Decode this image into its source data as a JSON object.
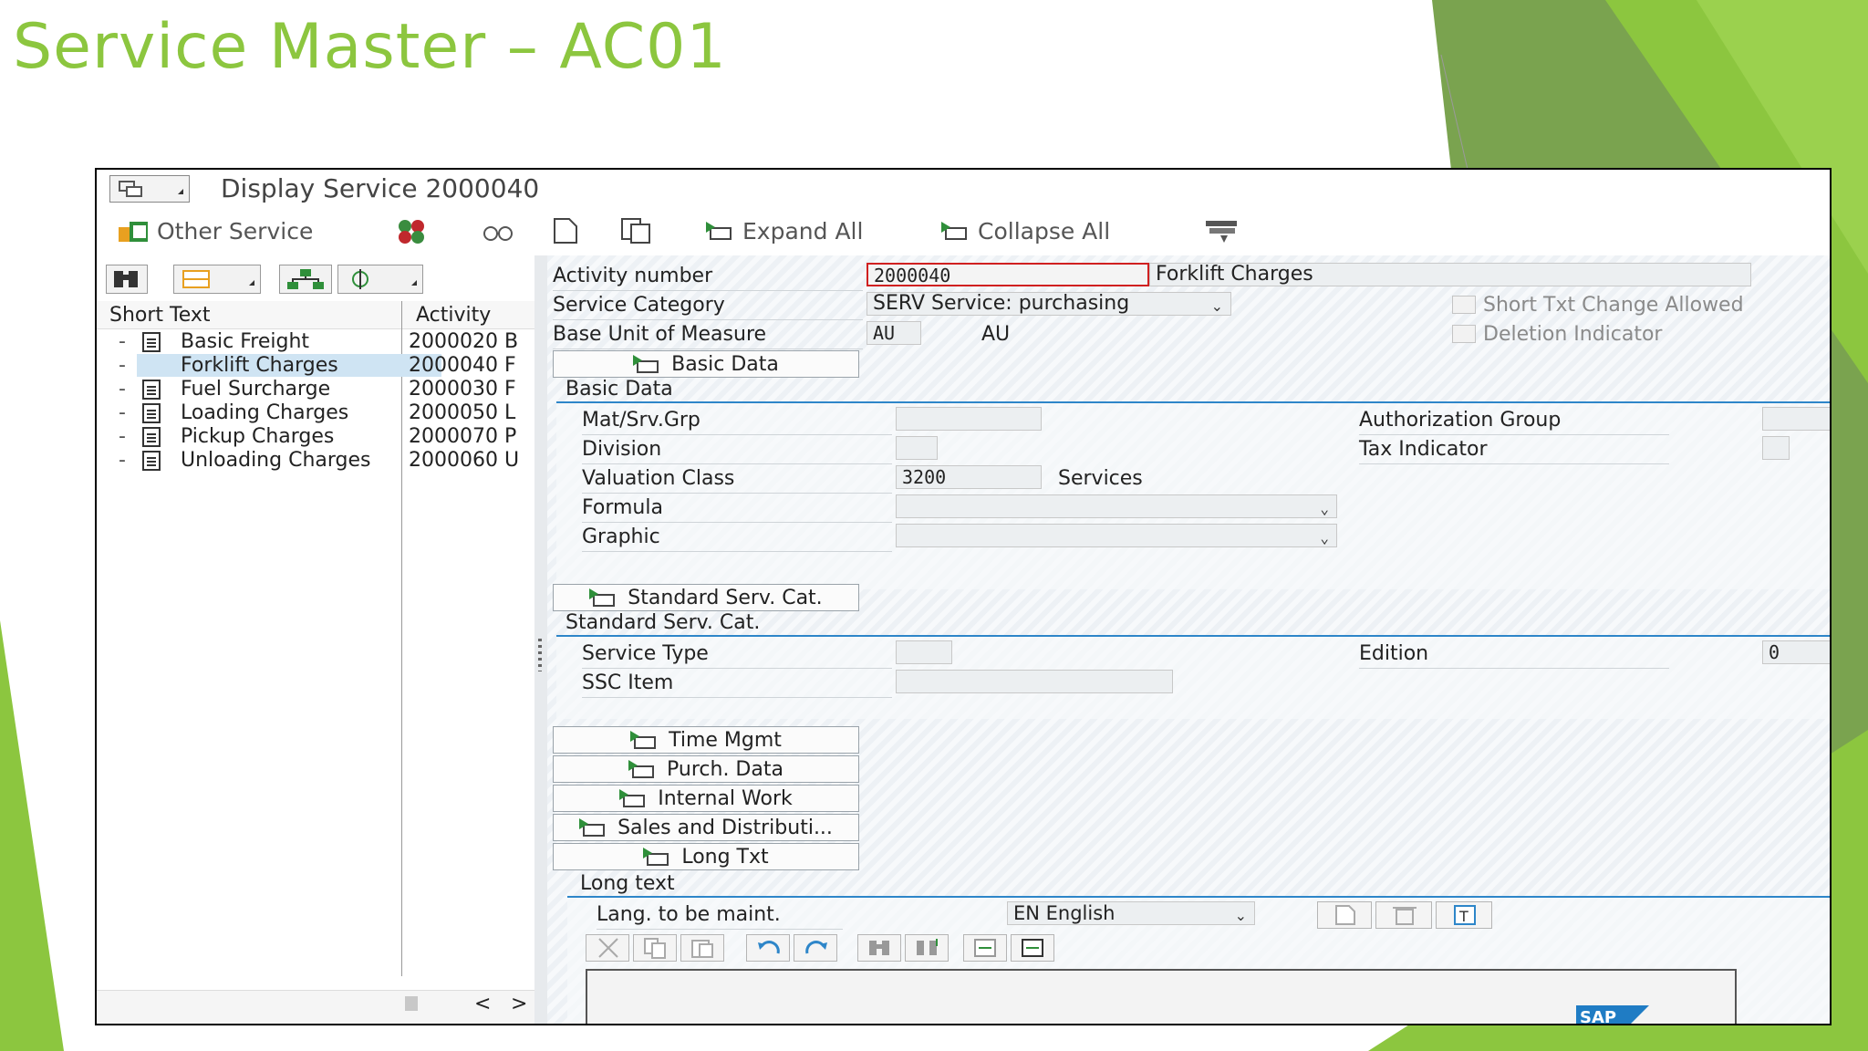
{
  "slide": {
    "title": "Service Master – AC01"
  },
  "colors": {
    "accent_green": "#8cc63f",
    "sap_blue": "#2e86c9",
    "selection": "#cfe4f3"
  },
  "window": {
    "title": "Display Service 2000040"
  },
  "toolbar": {
    "other_service": "Other Service",
    "expand_all": "Expand All",
    "collapse_all": "Collapse All"
  },
  "tree": {
    "headers": {
      "short_text": "Short Text",
      "activity": "Activity"
    },
    "rows": [
      {
        "text": "Basic Freight",
        "activity": "2000020 B"
      },
      {
        "text": "Forklift Charges",
        "activity": "2000040 F",
        "selected": true
      },
      {
        "text": "Fuel Surcharge",
        "activity": "2000030 F"
      },
      {
        "text": "Loading Charges",
        "activity": "2000050 L"
      },
      {
        "text": "Pickup Charges",
        "activity": "2000070 P"
      },
      {
        "text": "Unloading Charges",
        "activity": "2000060 U"
      }
    ],
    "scroll_left": "<",
    "scroll_right": ">"
  },
  "header_fields": {
    "activity_number_label": "Activity number",
    "activity_number": "2000040",
    "activity_description": "Forklift Charges",
    "service_category_label": "Service Category",
    "service_category": "SERV Service: purchasing",
    "base_unit_label": "Base Unit of Measure",
    "base_unit": "AU",
    "base_unit_text": "AU",
    "short_txt_change": "Short Txt Change Allowed",
    "deletion_indicator": "Deletion Indicator"
  },
  "basic_data": {
    "button": "Basic Data",
    "title": "Basic Data",
    "mat_srv_grp": "Mat/Srv.Grp",
    "division": "Division",
    "valuation_class_label": "Valuation Class",
    "valuation_class": "3200",
    "valuation_class_text": "Services",
    "formula": "Formula",
    "graphic": "Graphic",
    "authorization_group": "Authorization Group",
    "tax_indicator": "Tax Indicator"
  },
  "standard_serv_cat": {
    "button": "Standard Serv. Cat.",
    "title": "Standard Serv. Cat.",
    "service_type": "Service Type",
    "ssc_item": "SSC Item",
    "edition_label": "Edition",
    "edition": "0"
  },
  "sections": {
    "time_mgmt": "Time Mgmt",
    "purch_data": "Purch. Data",
    "internal_work": "Internal Work",
    "sales_distribution": "Sales and Distributi...",
    "long_txt": "Long Txt"
  },
  "long_text": {
    "title": "Long text",
    "lang_label": "Lang. to be maint.",
    "lang_value": "EN English"
  },
  "brand": {
    "logo_text": "SAP"
  }
}
